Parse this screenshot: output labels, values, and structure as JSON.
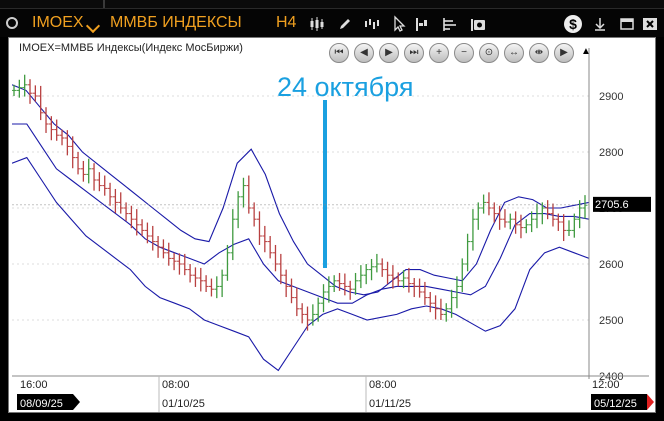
{
  "window": {
    "symbol": "IMOEX",
    "name": "ММВБ ИНДЕКСЫ",
    "timeframe": "H4"
  },
  "toolbar_icons": [
    "candles-icon",
    "pencil-icon",
    "bars-icon",
    "cursor-icon",
    "histogram-icon",
    "lines-icon",
    "camera-icon"
  ],
  "window_icons": [
    "dollar-icon",
    "download-icon",
    "minimize-icon",
    "close-icon"
  ],
  "chart": {
    "title": "IMOEX=ММВБ Индексы(Индекс МосБиржи)",
    "annotation": "24 октября",
    "current_price_label": "2705.6",
    "nav_buttons": [
      "first",
      "prev",
      "next",
      "last",
      "zoom-in",
      "zoom-out",
      "zoom-fit",
      "expand",
      "compress",
      "end",
      "collapse"
    ]
  },
  "chart_data": {
    "type": "ohlc-bars",
    "indicator": "Bollinger Bands",
    "y_axis": {
      "ticks": [
        2400,
        2500,
        2600,
        2700,
        2800,
        2900
      ],
      "range": [
        2400,
        2950
      ]
    },
    "x_axis": {
      "ticks": [
        {
          "time": "16:00",
          "date": "08/09/25"
        },
        {
          "time": "08:00",
          "date": "01/10/25"
        },
        {
          "time": "08:00",
          "date": "01/11/25"
        },
        {
          "time": "12:00",
          "date": "05/12/25"
        }
      ]
    },
    "last_price": 2705.6,
    "closes": [
      2910,
      2915,
      2920,
      2905,
      2900,
      2870,
      2850,
      2840,
      2830,
      2825,
      2810,
      2790,
      2770,
      2760,
      2770,
      2750,
      2740,
      2735,
      2720,
      2710,
      2700,
      2690,
      2680,
      2670,
      2660,
      2650,
      2640,
      2630,
      2620,
      2610,
      2605,
      2600,
      2590,
      2580,
      2575,
      2570,
      2560,
      2555,
      2560,
      2580,
      2620,
      2680,
      2720,
      2740,
      2700,
      2680,
      2650,
      2640,
      2620,
      2600,
      2580,
      2560,
      2540,
      2520,
      2510,
      2500,
      2510,
      2530,
      2550,
      2560,
      2570,
      2565,
      2560,
      2555,
      2570,
      2580,
      2590,
      2595,
      2600,
      2590,
      2580,
      2575,
      2570,
      2575,
      2565,
      2560,
      2550,
      2540,
      2530,
      2520,
      2510,
      2520,
      2540,
      2560,
      2600,
      2640,
      2680,
      2700,
      2710,
      2700,
      2690,
      2680,
      2675,
      2680,
      2670,
      2665,
      2670,
      2680,
      2690,
      2700,
      2690,
      2680,
      2675,
      2660,
      2660,
      2680,
      2700,
      2705
    ],
    "upper_band": [
      2920,
      2910,
      2880,
      2850,
      2830,
      2800,
      2780,
      2760,
      2740,
      2720,
      2700,
      2680,
      2660,
      2645,
      2640,
      2700,
      2780,
      2805,
      2760,
      2690,
      2640,
      2600,
      2580,
      2560,
      2550,
      2545,
      2550,
      2570,
      2590,
      2590,
      2580,
      2575,
      2570,
      2600,
      2660,
      2710,
      2720,
      2715,
      2700,
      2700,
      2705,
      2710
    ],
    "middle_band": [
      2850,
      2850,
      2810,
      2770,
      2750,
      2730,
      2710,
      2690,
      2670,
      2645,
      2630,
      2620,
      2610,
      2600,
      2620,
      2635,
      2645,
      2600,
      2570,
      2560,
      2550,
      2540,
      2530,
      2530,
      2545,
      2555,
      2560,
      2560,
      2560,
      2555,
      2550,
      2545,
      2560,
      2610,
      2670,
      2690,
      2690,
      2685,
      2685,
      2680
    ],
    "lower_band": [
      2780,
      2790,
      2750,
      2710,
      2680,
      2650,
      2630,
      2610,
      2590,
      2560,
      2540,
      2530,
      2520,
      2500,
      2490,
      2480,
      2470,
      2430,
      2410,
      2450,
      2490,
      2510,
      2520,
      2510,
      2500,
      2505,
      2510,
      2520,
      2525,
      2520,
      2510,
      2495,
      2480,
      2490,
      2520,
      2590,
      2620,
      2630,
      2620,
      2610
    ]
  }
}
